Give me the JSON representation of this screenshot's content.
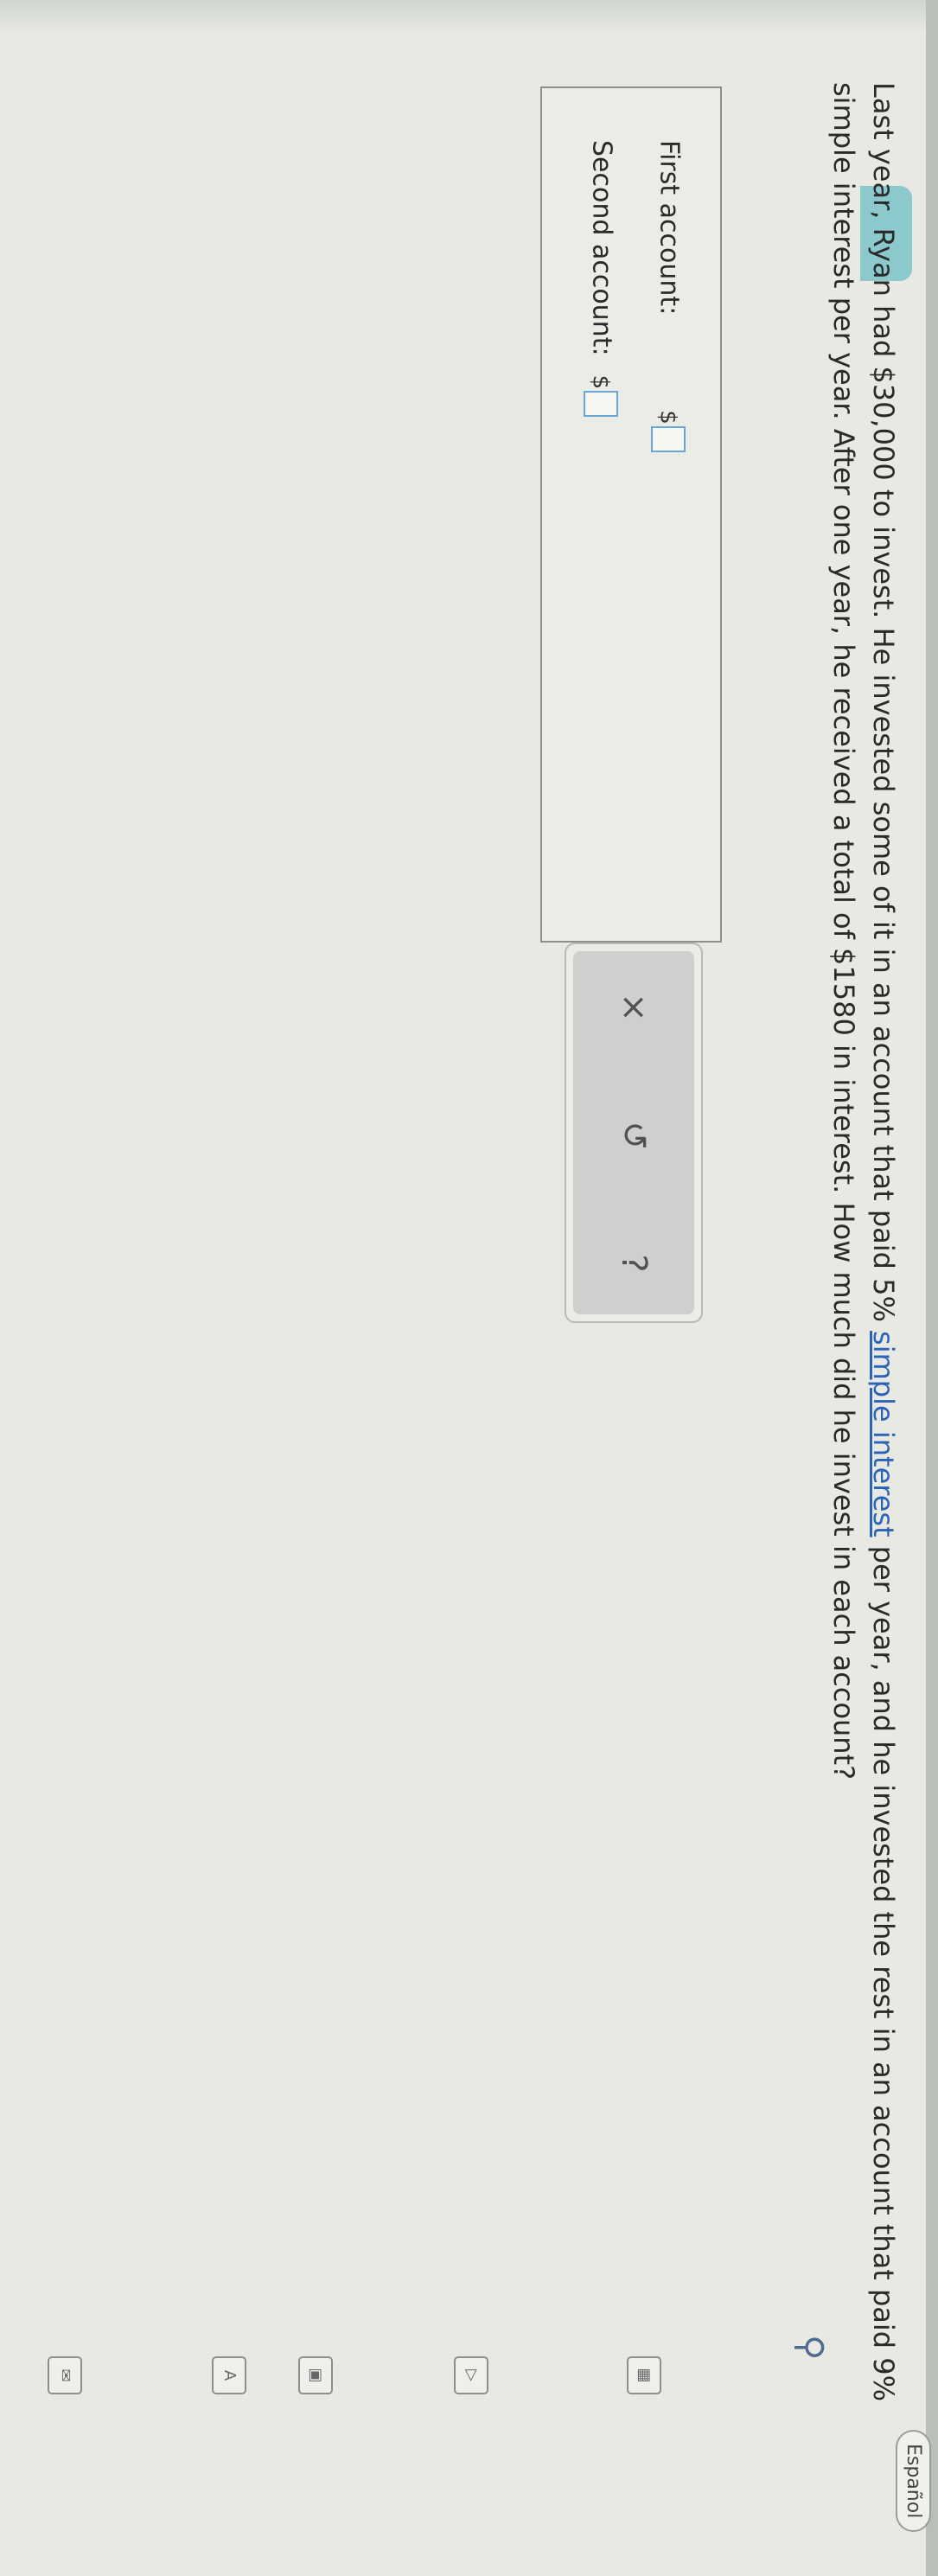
{
  "problem": {
    "text_before_link": "Last year, Ryan had $30,000 to invest. He invested some of it in an account that paid 5% ",
    "link_text": "simple interest",
    "text_after_link": " per year, and he invested the rest in an account that paid 9% simple interest per year. After one year, he received a total of $1580 in interest. How much did he invest in each account?"
  },
  "answers": {
    "first_label": "First account:",
    "second_label": "Second account:",
    "currency": "$",
    "first_value": "",
    "second_value": ""
  },
  "tools": {
    "clear": "×",
    "undo": "↺",
    "help": "?"
  },
  "header": {
    "language_button": "Español"
  },
  "sidebar": {
    "icons": [
      "account-icon",
      "calculator-icon",
      "video-icon",
      "calendar-icon",
      "text-size-icon",
      "mail-icon"
    ]
  }
}
